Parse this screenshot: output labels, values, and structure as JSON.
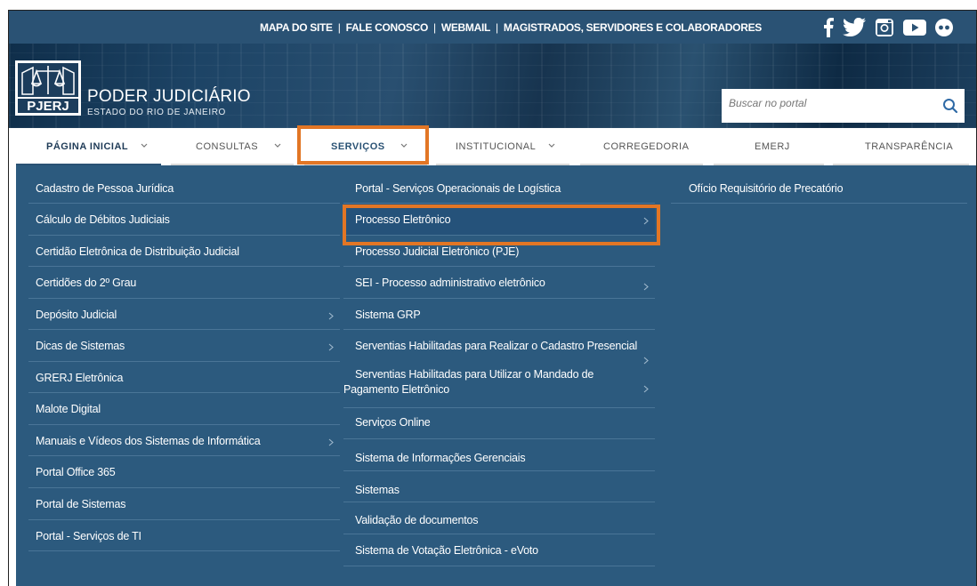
{
  "top_bar": {
    "links": [
      "MAPA DO SITE",
      "FALE CONOSCO",
      "WEBMAIL",
      "MAGISTRADOS, SERVIDORES E COLABORADORES"
    ],
    "separator": "|",
    "social_icons": [
      "facebook-icon",
      "twitter-icon",
      "instagram-icon",
      "youtube-icon",
      "flickr-icon"
    ]
  },
  "header": {
    "logo_text": "PJERJ",
    "title": "PODER JUDICIÁRIO",
    "subtitle": "ESTADO DO RIO DE JANEIRO",
    "search": {
      "placeholder": "Buscar no portal",
      "value": ""
    }
  },
  "nav": {
    "items": [
      {
        "label": "PÁGINA INICIAL",
        "has_dropdown": true
      },
      {
        "label": "CONSULTAS",
        "has_dropdown": true
      },
      {
        "label": "SERVIÇOS",
        "has_dropdown": true
      },
      {
        "label": "INSTITUCIONAL",
        "has_dropdown": true
      },
      {
        "label": "CORREGEDORIA",
        "has_dropdown": false
      },
      {
        "label": "EMERJ",
        "has_dropdown": false
      },
      {
        "label": "TRANSPARÊNCIA",
        "has_dropdown": false
      }
    ],
    "active": "PÁGINA INICIAL",
    "highlighted": "SERVIÇOS"
  },
  "menu": {
    "columns": [
      [
        {
          "label": "Cadastro de Pessoa Jurídica",
          "submenu": false
        },
        {
          "label": "Cálculo de Débitos Judiciais",
          "submenu": false
        },
        {
          "label": "Certidão Eletrônica de Distribuição Judicial",
          "submenu": false
        },
        {
          "label": "Certidões do 2º Grau",
          "submenu": false
        },
        {
          "label": "Depósito Judicial",
          "submenu": true
        },
        {
          "label": "Dicas de Sistemas",
          "submenu": true
        },
        {
          "label": "GRERJ Eletrônica",
          "submenu": false
        },
        {
          "label": "Malote Digital",
          "submenu": false
        },
        {
          "label": "Manuais e Vídeos dos Sistemas de Informática",
          "submenu": true
        },
        {
          "label": "Portal Office 365",
          "submenu": false
        },
        {
          "label": "Portal de Sistemas",
          "submenu": false
        },
        {
          "label": "Portal - Serviços de TI",
          "submenu": false
        }
      ],
      [
        {
          "label": "Portal - Serviços Operacionais de Logística",
          "submenu": false
        },
        {
          "label": "Processo Eletrônico",
          "submenu": true
        },
        {
          "label": "Processo Judicial Eletrônico (PJE)",
          "submenu": false
        },
        {
          "label": "SEI - Processo administrativo eletrônico",
          "submenu": true
        },
        {
          "label": "Sistema GRP",
          "submenu": false
        },
        {
          "label": "Serventias Habilitadas para Realizar o Cadastro Presencial",
          "submenu": true
        },
        {
          "label": "Serventias Habilitadas para Utilizar o Mandado de",
          "label2": "Pagamento Eletrônico",
          "submenu": true
        },
        {
          "label": "Serviços Online",
          "submenu": false
        },
        {
          "label": "Sistema de Informações Gerenciais",
          "submenu": false
        },
        {
          "label": "Sistemas",
          "submenu": false
        },
        {
          "label": "Validação de documentos",
          "submenu": false
        },
        {
          "label": "Sistema de Votação Eletrônica - eVoto",
          "submenu": false
        }
      ],
      [
        {
          "label": "Ofício Requisitório de Precatório",
          "submenu": false
        }
      ]
    ],
    "highlighted_item": "Processo Eletrônico"
  },
  "colors": {
    "top_bar": "#2a5274",
    "menu_bg": "#2c5a7e",
    "menu_divider": "#4a7597",
    "highlight": "#e27625"
  }
}
